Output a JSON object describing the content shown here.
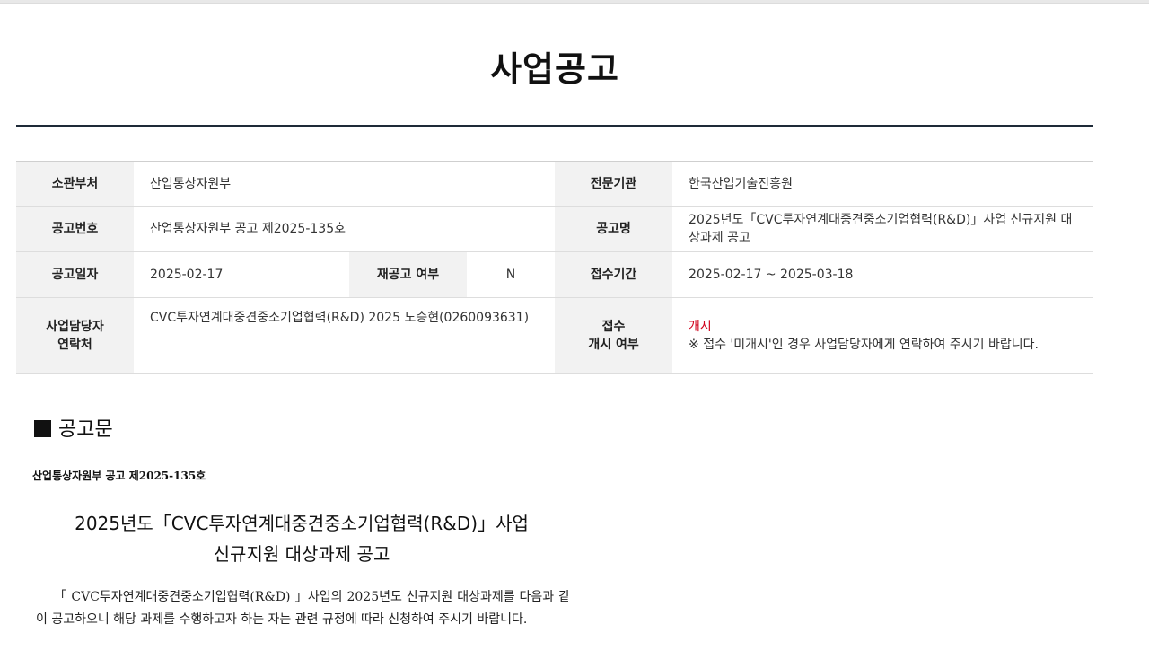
{
  "page_title": "사업공고",
  "info_table": {
    "rows": [
      {
        "label1": "소관부처",
        "value1": "산업통상자원부",
        "label2": "전문기관",
        "value2": "한국산업기술진흥원"
      },
      {
        "label1": "공고번호",
        "value1": "산업통상자원부 공고 제2025-135호",
        "label2": "공고명",
        "value2": "2025년도「CVC투자연계대중견중소기업협력(R&D)」사업 신규지원 대상과제 공고"
      },
      {
        "label1": "공고일자",
        "value1": "2025-02-17",
        "label_mid": "재공고 여부",
        "value_mid": "N",
        "label2": "접수기간",
        "value2": "2025-02-17 ~ 2025-03-18"
      },
      {
        "label1_line1": "사업담당자",
        "label1_line2": "연락처",
        "value1": "CVC투자연계대중견중소기업협력(R&D) 2025 노승현(0260093631)",
        "label2_line1": "접수",
        "label2_line2": "개시 여부",
        "value2_status": "개시",
        "value2_note": "※ 접수 '미개시'인 경우 사업담당자에게 연락하여 주시기 바랍니다."
      }
    ]
  },
  "section": {
    "title": "공고문"
  },
  "notice": {
    "number": "산업통상자원부 공고 제2025-135호",
    "heading_line1": "2025년도「CVC투자연계대중견중소기업협력(R&D)」사업",
    "heading_line2": "신규지원 대상과제 공고",
    "body": "「 CVC투자연계대중견중소기업협력(R&D) 」사업의 2025년도 신규지원 대상과제를 다음과 같이 공고하오니 해당 과제를 수행하고자 하는 자는 관련 규정에 따라 신청하여 주시기 바랍니다."
  },
  "colors": {
    "title_rule": "#1e2a38",
    "header_cell_bg": "#f2f2f2",
    "open_status": "#d0021b"
  }
}
